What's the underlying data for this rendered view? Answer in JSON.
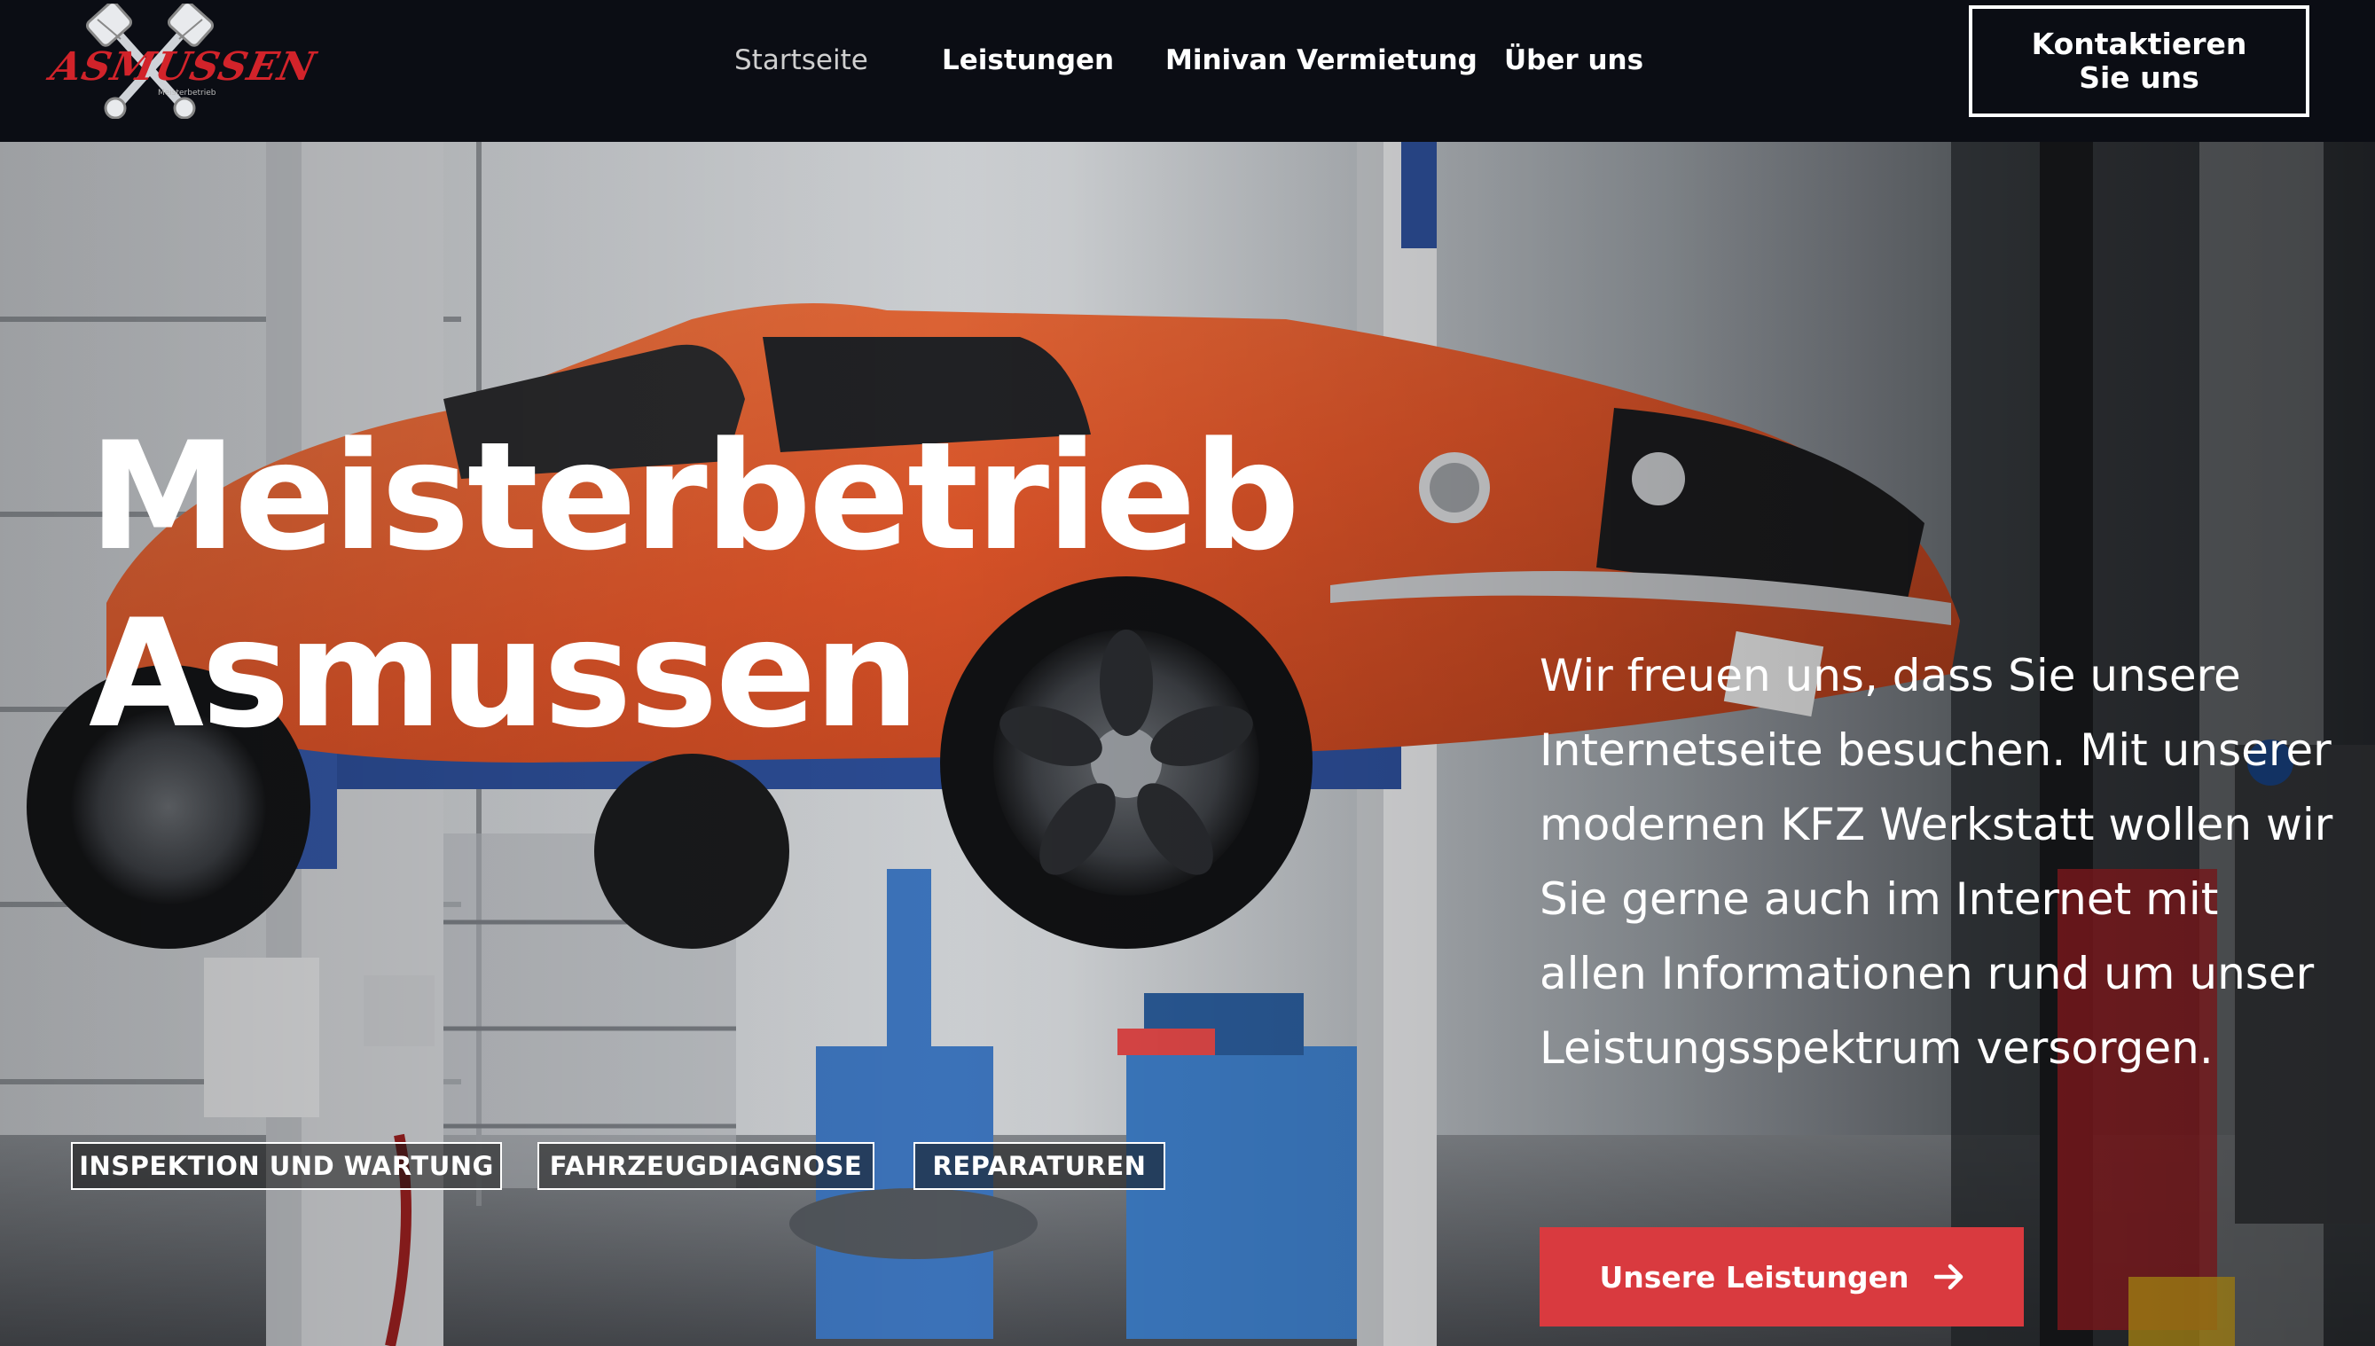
{
  "header": {
    "logo": {
      "name": "ASMUSSEN",
      "sub": "Meisterbetrieb"
    },
    "nav": [
      {
        "label": "Startseite",
        "active": true
      },
      {
        "label": "Leistungen",
        "active": false
      },
      {
        "label": "Minivan Vermietung",
        "active": false
      },
      {
        "label": "Über uns",
        "active": false
      }
    ],
    "contact_button": "Kontaktieren Sie uns"
  },
  "hero": {
    "title_line1": "Meisterbetrieb",
    "title_line2": "Asmussen",
    "text": "Wir freuen uns, dass Sie unsere Internetseite besuchen. Mit unserer modernen KFZ Werkstatt wollen wir Sie gerne auch im Internet mit allen Informationen rund um unser Leistungsspektrum versorgen.",
    "cta_label": "Unsere Leistungen",
    "cta_icon": "arrow-right-icon",
    "tags": [
      "INSPEKTION UND WARTUNG",
      "FAHRZEUGDIAGNOSE",
      "REPARATUREN"
    ]
  },
  "colors": {
    "header_bg": "#0b0d14",
    "brand_red": "#d2232a",
    "cta_red": "#d93a3f",
    "car_orange": "#e2562a"
  }
}
